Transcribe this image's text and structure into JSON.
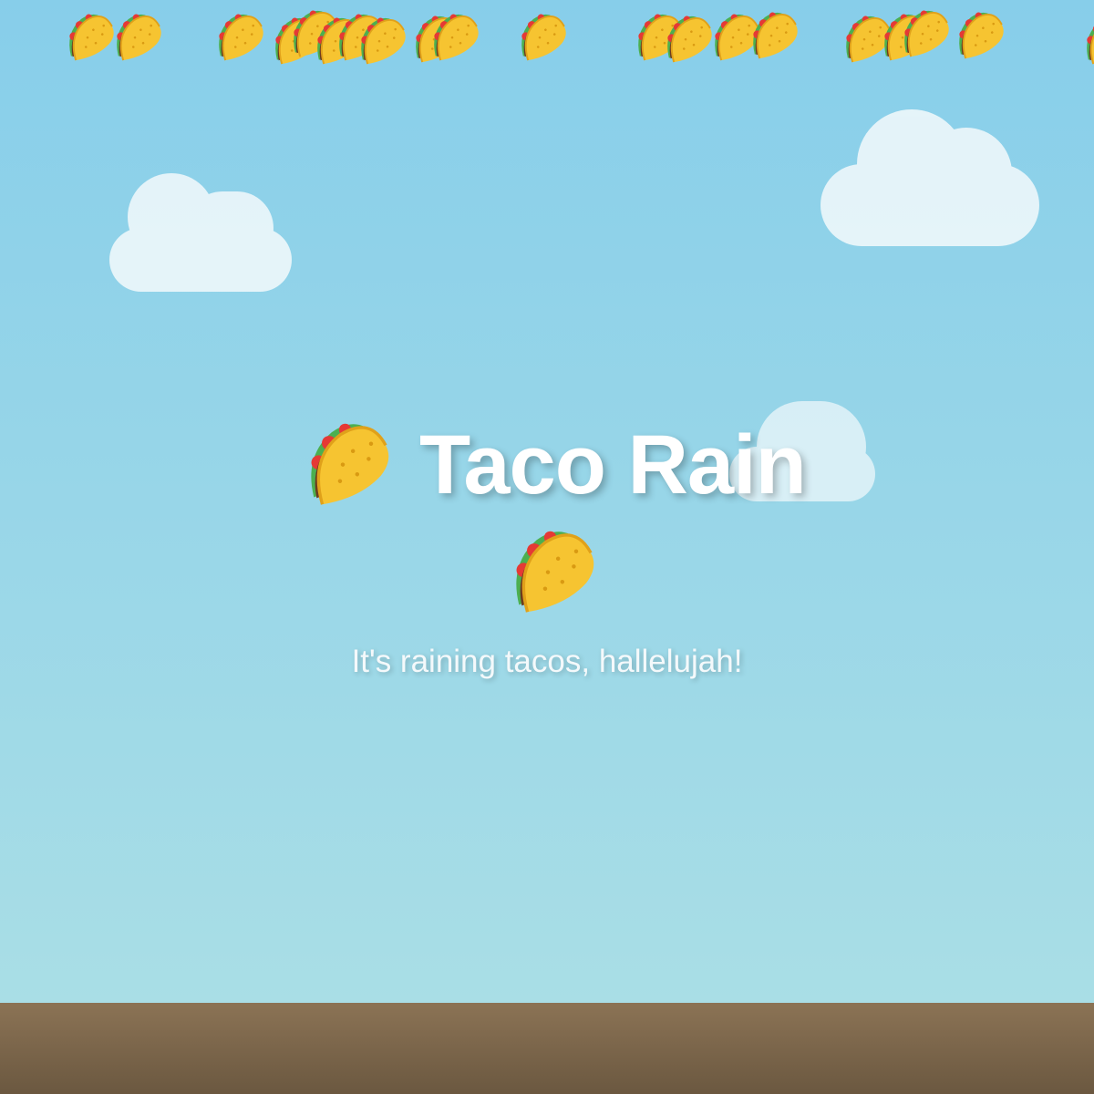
{
  "hero": {
    "title": "Taco Rain",
    "subtitle": "It's raining tacos, hallelujah!"
  },
  "icons": {
    "taco": "taco-icon",
    "cloud": "cloud-icon"
  },
  "colors": {
    "sky_top": "#87ceea",
    "sky_bottom": "#a9dee6",
    "ground_top": "#8b7355",
    "ground_bottom": "#6b5840",
    "title": "#ffffff",
    "cloud": "#f4fafc"
  }
}
